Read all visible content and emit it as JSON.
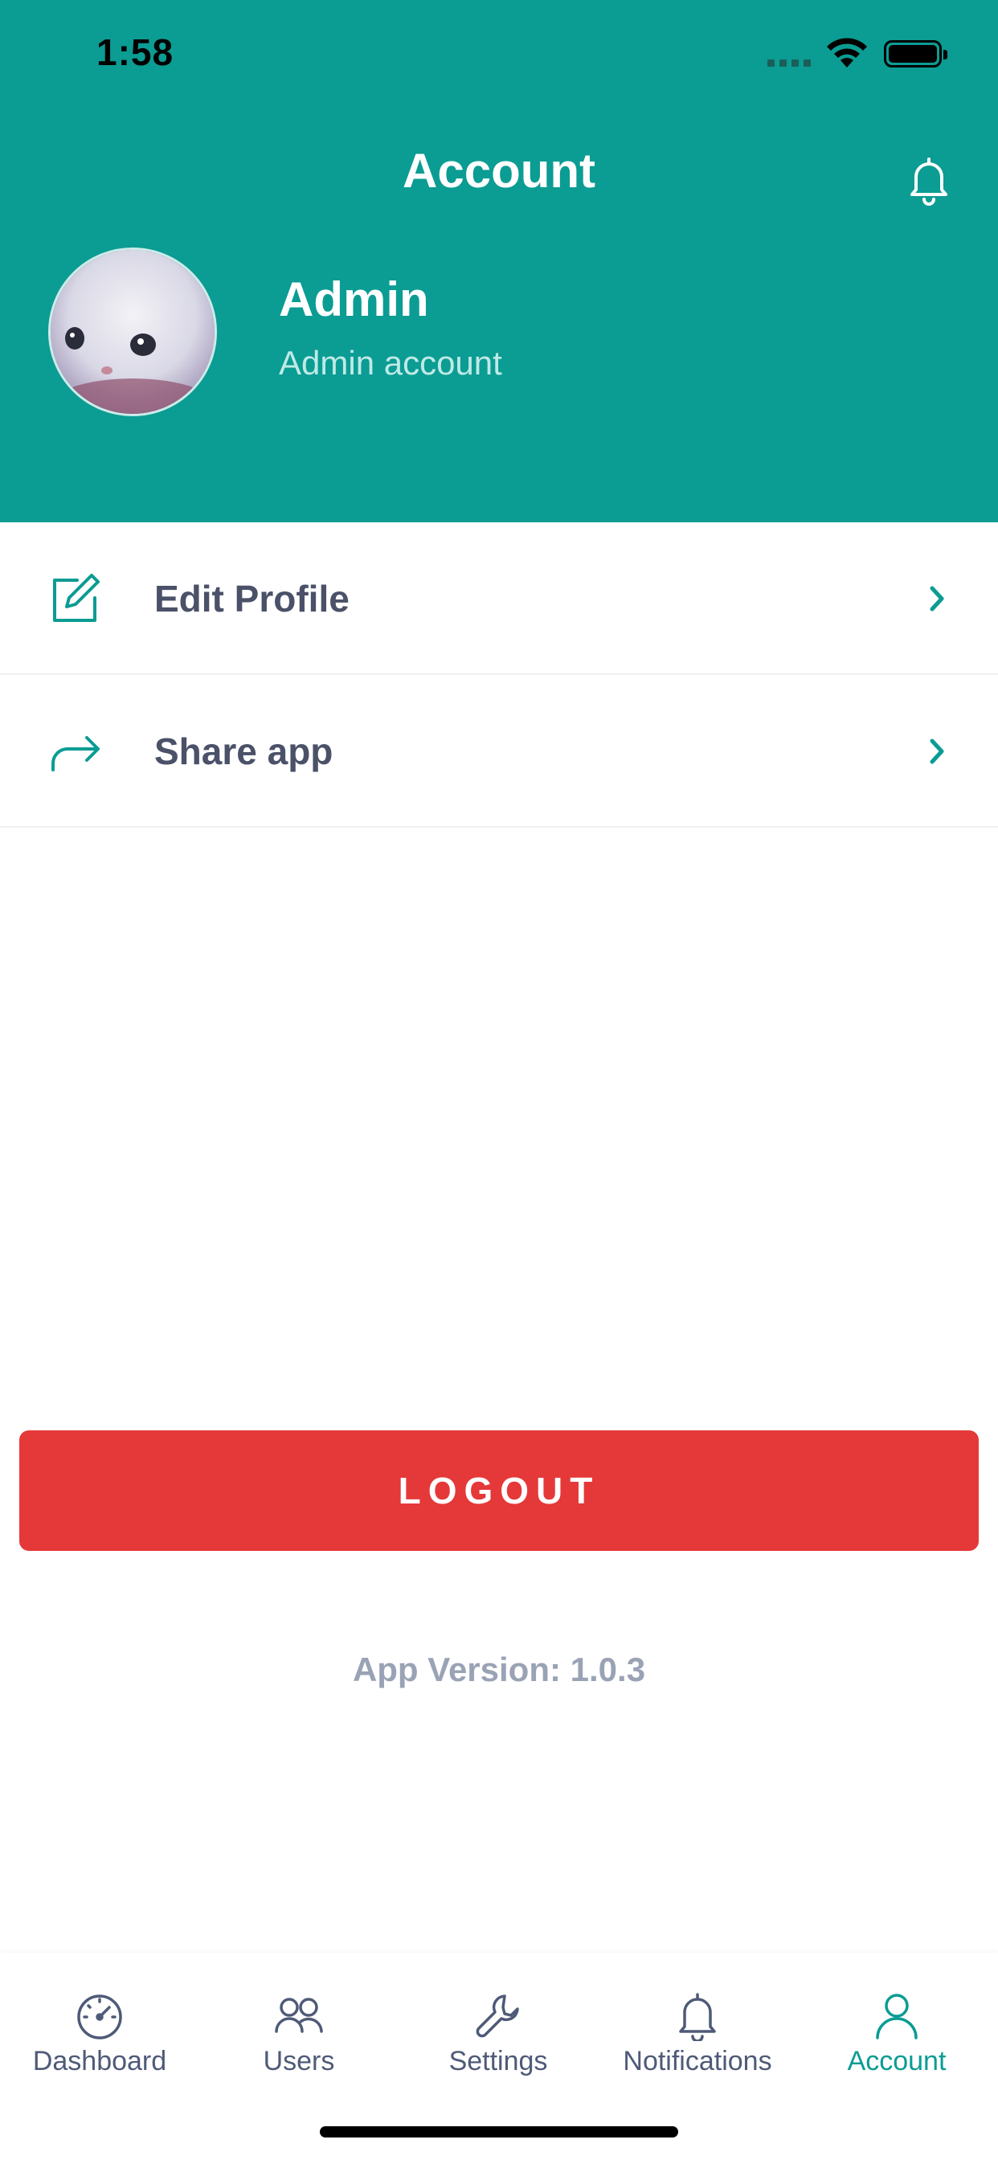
{
  "status_bar": {
    "time": "1:58"
  },
  "header": {
    "title": "Account",
    "profile": {
      "name": "Admin",
      "subtitle": "Admin account"
    }
  },
  "menu": {
    "items": [
      {
        "label": "Edit Profile",
        "icon": "edit-icon"
      },
      {
        "label": "Share app",
        "icon": "share-icon"
      }
    ]
  },
  "logout_label": "LOGOUT",
  "version_text": "App Version: 1.0.3",
  "tabbar": {
    "items": [
      {
        "label": "Dashboard",
        "icon": "dashboard-icon",
        "active": false
      },
      {
        "label": "Users",
        "icon": "users-icon",
        "active": false
      },
      {
        "label": "Settings",
        "icon": "wrench-icon",
        "active": false
      },
      {
        "label": "Notifications",
        "icon": "bell-icon",
        "active": false
      },
      {
        "label": "Account",
        "icon": "user-icon",
        "active": true
      }
    ]
  },
  "colors": {
    "primary": "#0b9c93",
    "danger": "#e53838",
    "text": "#4a5168",
    "muted": "#9aa3b5"
  }
}
